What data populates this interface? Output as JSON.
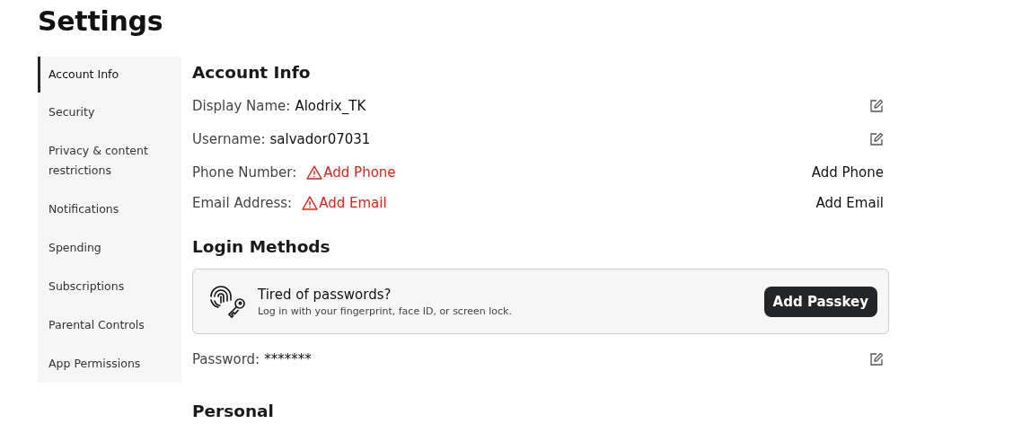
{
  "title": "Settings",
  "sidebar": {
    "items": [
      {
        "label": "Account Info",
        "selected": true
      },
      {
        "label": "Security",
        "selected": false
      },
      {
        "label": "Privacy & content restrictions",
        "selected": false
      },
      {
        "label": "Notifications",
        "selected": false
      },
      {
        "label": "Spending",
        "selected": false
      },
      {
        "label": "Subscriptions",
        "selected": false
      },
      {
        "label": "Parental Controls",
        "selected": false
      },
      {
        "label": "App Permissions",
        "selected": false
      }
    ]
  },
  "account_info": {
    "heading": "Account Info",
    "rows": [
      {
        "kind": "edit",
        "label": "Display Name:",
        "value": "Alodrix_TK"
      },
      {
        "kind": "edit",
        "label": "Username:",
        "value": "salvador07031"
      },
      {
        "kind": "missing",
        "label": "Phone Number:",
        "value": "Add Phone",
        "action": "Add Phone"
      },
      {
        "kind": "missing",
        "label": "Email Address:",
        "value": "Add Email",
        "action": "Add Email"
      }
    ]
  },
  "login_methods": {
    "heading": "Login Methods",
    "passkey_card": {
      "title": "Tired of passwords?",
      "text": "Log in with your fingerprint, face ID, or screen lock.",
      "button": "Add Passkey"
    },
    "rows": [
      {
        "kind": "edit",
        "label": "Password:",
        "value": "*******"
      }
    ]
  },
  "personal": {
    "heading": "Personal"
  }
}
